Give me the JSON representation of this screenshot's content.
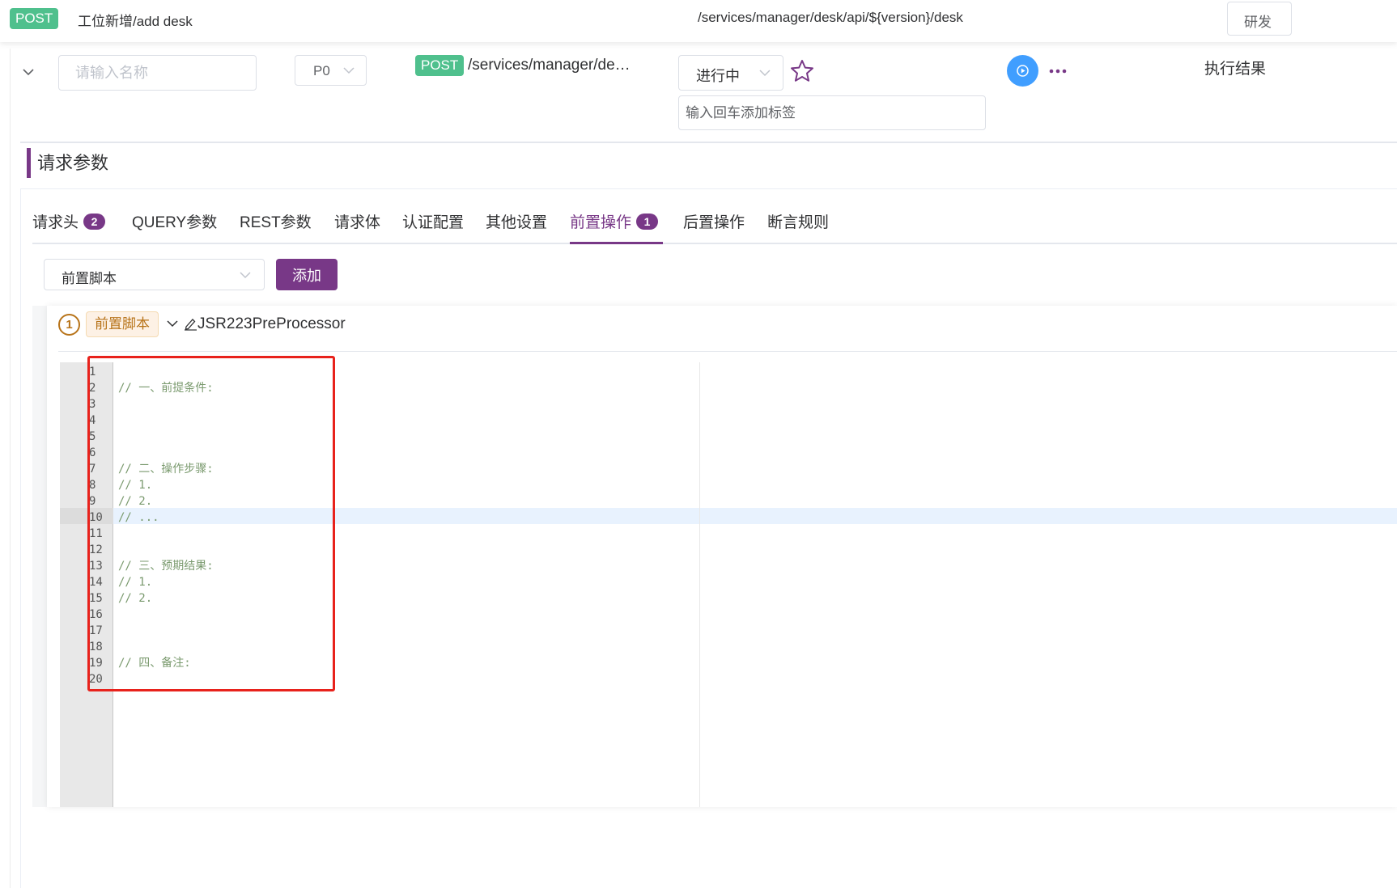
{
  "header": {
    "method": "POST",
    "title": "工位新增/add desk",
    "path": "/services/manager/desk/api/${version}/desk",
    "env_label": "研发"
  },
  "api": {
    "name_placeholder": "请输入名称",
    "priority": "P0",
    "method": "POST",
    "path": "/services/manager/de…",
    "status": "进行中",
    "tag_placeholder": "输入回车添加标签",
    "exec_result": "执行结果"
  },
  "section": {
    "title": "请求参数"
  },
  "tabs": [
    {
      "label": "请求头",
      "count": "2"
    },
    {
      "label": "QUERY参数"
    },
    {
      "label": "REST参数"
    },
    {
      "label": "请求体"
    },
    {
      "label": "认证配置"
    },
    {
      "label": "其他设置"
    },
    {
      "label": "前置操作",
      "count": "1",
      "active": true
    },
    {
      "label": "后置操作"
    },
    {
      "label": "断言规则"
    }
  ],
  "script": {
    "select_value": "前置脚本",
    "add_label": "添加"
  },
  "processor": {
    "index": "1",
    "type": "前置脚本",
    "name": "JSR223PreProcessor"
  },
  "editor": {
    "active_line": 10,
    "lines": [
      "",
      "// 一、前提条件:",
      "",
      "",
      "",
      "",
      "// 二、操作步骤:",
      "// 1.",
      "// 2.",
      "// ...",
      "",
      "",
      "// 三、预期结果:",
      "// 1.",
      "// 2.",
      "",
      "",
      "",
      "// 四、备注:",
      ""
    ]
  },
  "colors": {
    "accent": "#783887",
    "post_badge": "#4fc08d",
    "run_button": "#409eff",
    "highlight": "#e8221c",
    "processor_tag": "#b8741a"
  }
}
